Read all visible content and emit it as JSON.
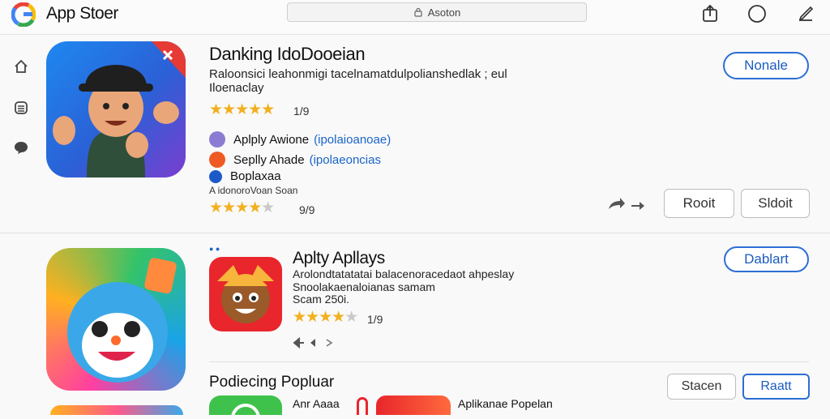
{
  "header": {
    "app_title": "App Stoer",
    "search_placeholder": "Asoton"
  },
  "listing1": {
    "name": "Danking IdoDooeian",
    "desc_line1": "Raloonsici leahonmigi tacelnamatdulpolianshedlak ; eul",
    "desc_line2": "Iloenaclay",
    "rating_count": "1/9",
    "sub_items": [
      {
        "label": "Aplply Awione",
        "link": "(ipolaioanoae)"
      },
      {
        "label": "Seplly Ahade",
        "link": "(ipolaeoncias"
      },
      {
        "label": "Boplaxaa",
        "link": ""
      }
    ],
    "note": "A idonoroVoan Soan",
    "rating_count2": "9/9",
    "primary_button": "Nonale",
    "button_a": "Rooit",
    "button_b": "Sldoit"
  },
  "listing2": {
    "name": "Aplty Apllays",
    "desc_line1": "Arolondtatatatai balacenoracedaot ahpeslay",
    "desc_line2": "Snoolakaenaloianas samam",
    "desc_line3": "Scam 250i.",
    "rating_count": "1/9",
    "primary_button": "Dablart"
  },
  "popular": {
    "heading": "Podiecing Popluar",
    "button_a": "Stacen",
    "button_b": "Raatt",
    "item_a": "Anr Aaaa",
    "item_b": "Aplikanae Popelan"
  },
  "colors": {
    "accent": "#2c6ed5",
    "star": "#f2b01e"
  }
}
